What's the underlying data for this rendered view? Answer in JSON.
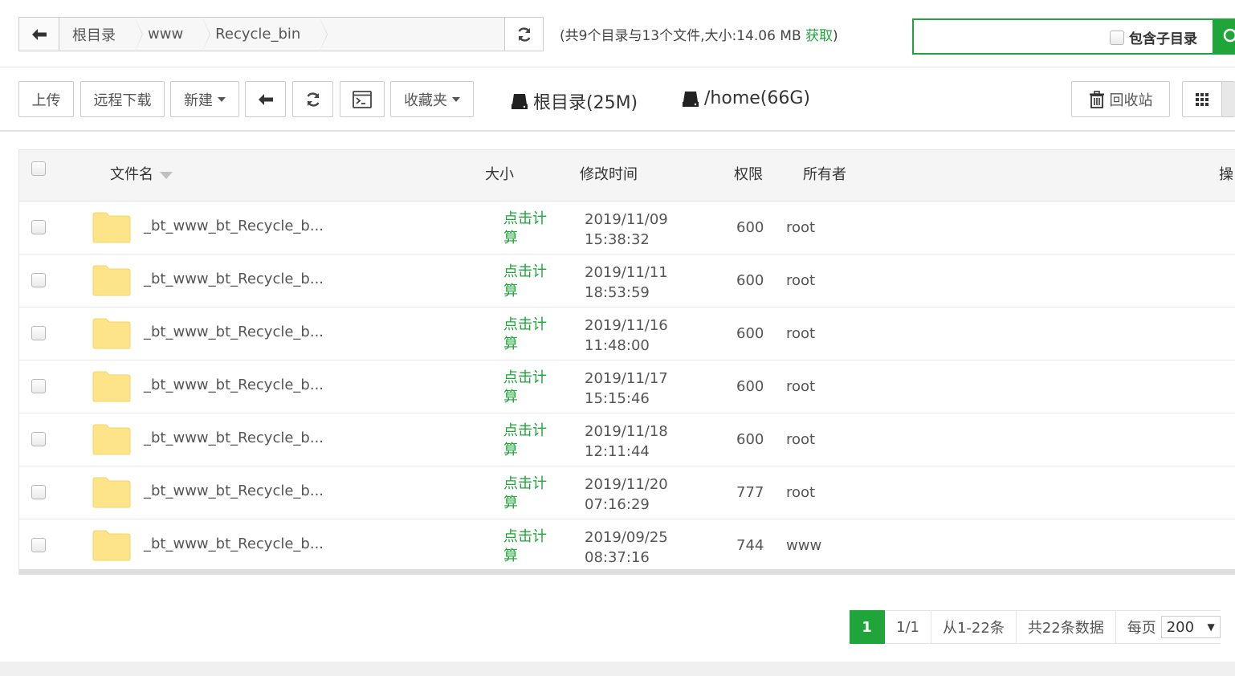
{
  "breadcrumb": {
    "items": [
      "根目录",
      "www",
      "Recycle_bin"
    ]
  },
  "dir_info": {
    "prefix": "(共9个目录与13个文件,大小:14.06 MB ",
    "get_link": "获取",
    "suffix": ")"
  },
  "search": {
    "value": "",
    "placeholder": "",
    "include_subdir_label": "包含子目录"
  },
  "toolbar": {
    "upload": "上传",
    "remote_download": "远程下载",
    "new": "新建",
    "favorites": "收藏夹",
    "recycle_bin": "回收站",
    "disks": [
      "根目录(25M)",
      "/home(66G)"
    ]
  },
  "table": {
    "headers": {
      "name": "文件名",
      "size": "大小",
      "mtime": "修改时间",
      "perm": "权限",
      "owner": "所有者",
      "ops": "操"
    },
    "rows": [
      {
        "name": "_bt_www_bt_Recycle_b...",
        "size": "点击计算",
        "date": "2019/11/09",
        "time": "15:38:32",
        "perm": "600",
        "owner": "root"
      },
      {
        "name": "_bt_www_bt_Recycle_b...",
        "size": "点击计算",
        "date": "2019/11/11",
        "time": "18:53:59",
        "perm": "600",
        "owner": "root"
      },
      {
        "name": "_bt_www_bt_Recycle_b...",
        "size": "点击计算",
        "date": "2019/11/16",
        "time": "11:48:00",
        "perm": "600",
        "owner": "root"
      },
      {
        "name": "_bt_www_bt_Recycle_b...",
        "size": "点击计算",
        "date": "2019/11/17",
        "time": "15:15:46",
        "perm": "600",
        "owner": "root"
      },
      {
        "name": "_bt_www_bt_Recycle_b...",
        "size": "点击计算",
        "date": "2019/11/18",
        "time": "12:11:44",
        "perm": "600",
        "owner": "root"
      },
      {
        "name": "_bt_www_bt_Recycle_b...",
        "size": "点击计算",
        "date": "2019/11/20",
        "time": "07:16:29",
        "perm": "777",
        "owner": "root"
      },
      {
        "name": "_bt_www_bt_Recycle_b...",
        "size": "点击计算",
        "date": "2019/09/25",
        "time": "08:37:16",
        "perm": "744",
        "owner": "www"
      }
    ]
  },
  "pagination": {
    "current": "1",
    "page_of": "1/1",
    "range": "从1-22条",
    "total": "共22条数据",
    "per_page_label": "每页",
    "per_page_value": "200"
  },
  "colors": {
    "accent": "#20a53a",
    "folder": "#fde489"
  }
}
